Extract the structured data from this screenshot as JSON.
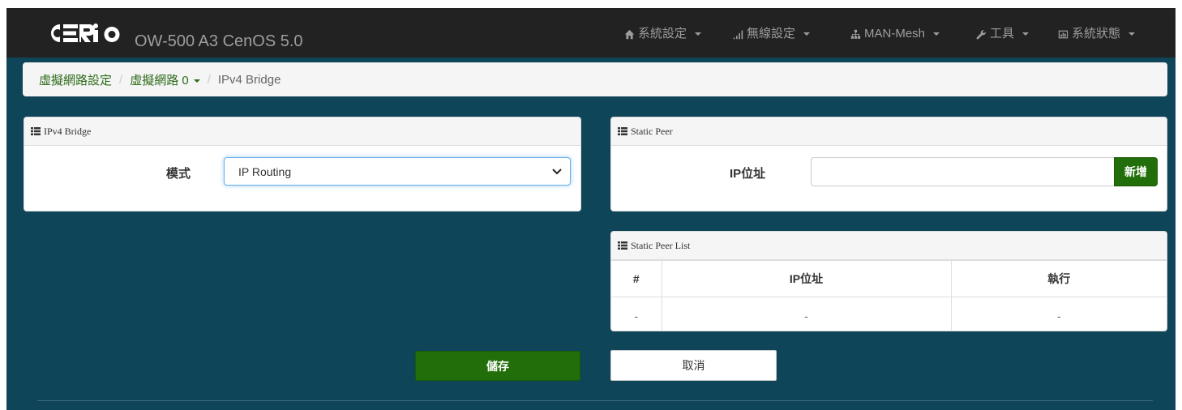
{
  "app": {
    "product_title": "OW-500 A3   CenOS 5.0",
    "brand_color": "#ffffff",
    "accent_color": "#216e0a"
  },
  "nav": {
    "items": [
      {
        "label": "系統設定",
        "icon": "home-icon"
      },
      {
        "label": "無線設定",
        "icon": "signal-bars-icon"
      },
      {
        "label": "MAN-Mesh",
        "icon": "sitemap-icon"
      },
      {
        "label": "工具",
        "icon": "wrench-icon"
      },
      {
        "label": "系統狀態",
        "icon": "dashboard-icon"
      }
    ]
  },
  "breadcrumb": {
    "items": [
      "虛擬網路設定",
      "虛擬網路 0",
      "IPv4 Bridge"
    ],
    "separator": "/"
  },
  "ipv4_bridge_panel": {
    "heading": "IPv4 Bridge",
    "mode_label": "模式",
    "mode_value": "IP Routing"
  },
  "static_peer_panel": {
    "heading": "Static Peer",
    "ip_label": "IP位址",
    "ip_value": "",
    "add_label": "新增"
  },
  "static_peer_list": {
    "heading": "Static Peer List",
    "columns": [
      "#",
      "IP位址",
      "執行"
    ],
    "rows": [
      [
        "-",
        "-",
        "-"
      ]
    ]
  },
  "actions": {
    "save_label": "儲存",
    "cancel_label": "取消"
  }
}
